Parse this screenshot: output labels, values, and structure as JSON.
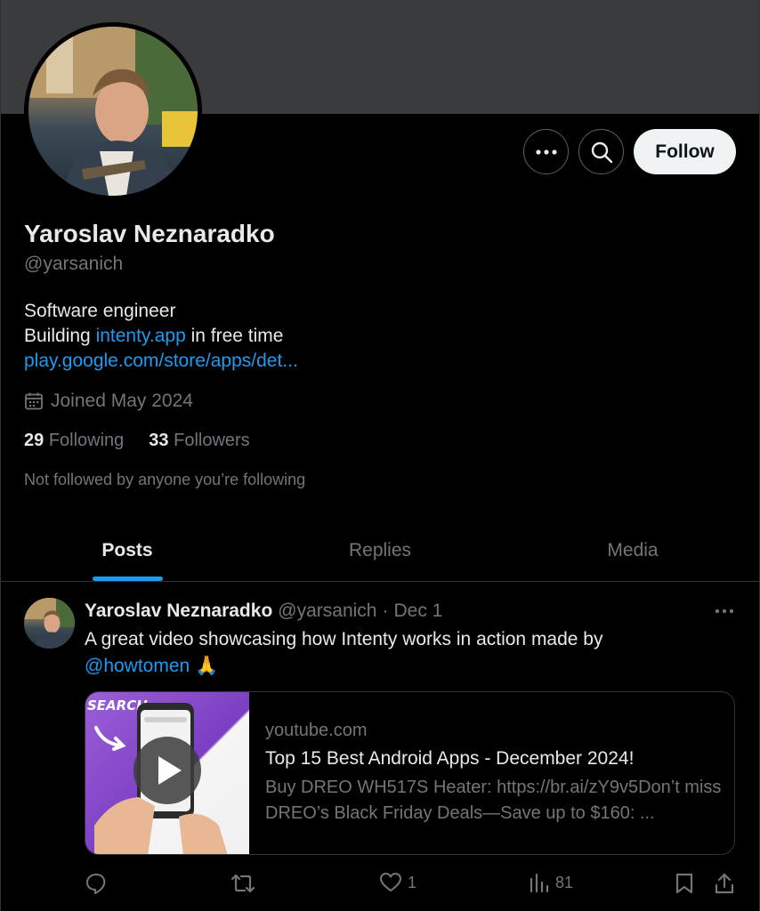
{
  "profile": {
    "display_name": "Yaroslav Neznaradko",
    "handle": "@yarsanich",
    "bio_line1": "Software engineer",
    "bio_line2_prefix": "Building ",
    "bio_link": "intenty.app",
    "bio_line2_suffix": " in free time",
    "website": "play.google.com/store/apps/det...",
    "joined": "Joined May 2024",
    "following_count": "29",
    "following_label": "Following",
    "followers_count": "33",
    "followers_label": "Followers",
    "not_followed": "Not followed by anyone you’re following"
  },
  "buttons": {
    "follow": "Follow",
    "more_icon": "ellipsis-icon",
    "search_icon": "search-icon"
  },
  "tabs": [
    {
      "label": "Posts",
      "active": true
    },
    {
      "label": "Replies",
      "active": false
    },
    {
      "label": "Media",
      "active": false
    }
  ],
  "post": {
    "author": "Yaroslav Neznaradko",
    "handle": "@yarsanich",
    "dot": "·",
    "date": "Dec 1",
    "text": "A great video showcasing how Intenty works in action made by",
    "mention": "@howtomen",
    "emoji": "🙏",
    "card": {
      "thumb_text": "SEARCH",
      "domain": "youtube.com",
      "title": "Top 15 Best Android Apps - December 2024!",
      "description": "Buy DREO WH517S Heater: https://br.ai/zY9v5Don’t miss DREO’s Black Friday Deals—Save up to $160: ..."
    },
    "actions": {
      "reply_count": "",
      "repost_count": "",
      "like_count": "1",
      "views_count": "81"
    }
  },
  "colors": {
    "background": "#000000",
    "banner": "#3a3b3d",
    "accent": "#1d9bf0",
    "text": "#e7e9ea",
    "muted": "#71767b",
    "border": "#2f3336"
  }
}
